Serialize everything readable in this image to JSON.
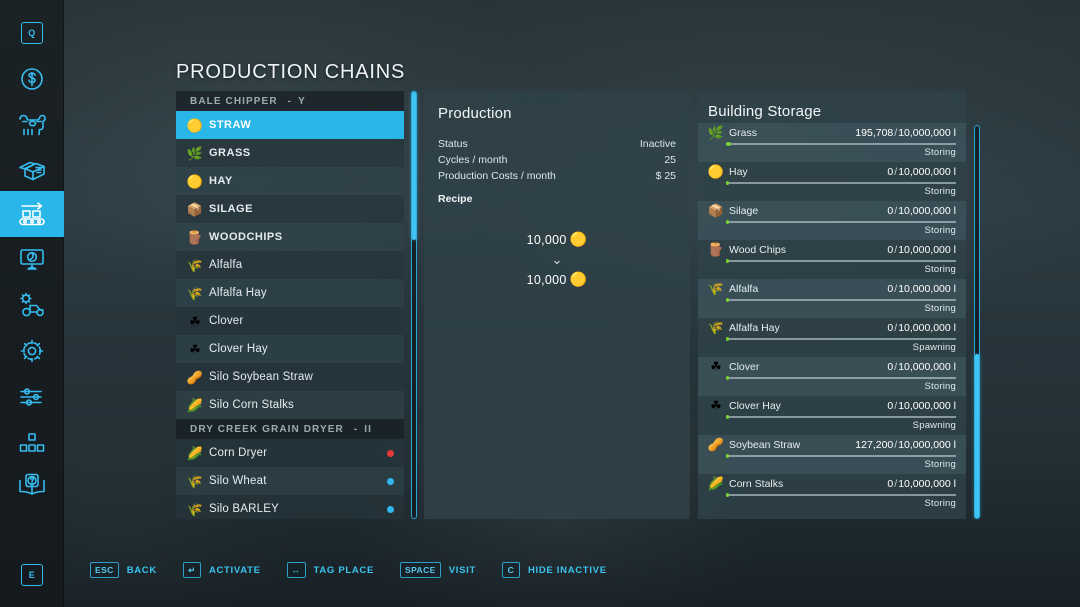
{
  "page_title": "PRODUCTION CHAINS",
  "sidebar": {
    "items": [
      {
        "name": "quests-icon",
        "label": "Q"
      },
      {
        "name": "finances-icon",
        "label": "$"
      },
      {
        "name": "animals-icon",
        "label": "Animals"
      },
      {
        "name": "contracts-icon",
        "label": "Contracts"
      },
      {
        "name": "production-icon",
        "label": "Production",
        "active": true
      },
      {
        "name": "map-overview-icon",
        "label": "Map Overview"
      },
      {
        "name": "vehicles-icon",
        "label": "Vehicles"
      },
      {
        "name": "settings-icon",
        "label": "Settings"
      },
      {
        "name": "game-settings-icon",
        "label": "Game Settings"
      },
      {
        "name": "statistics-icon",
        "label": "Statistics"
      },
      {
        "name": "help-icon",
        "label": "Help"
      },
      {
        "name": "exit-icon",
        "label": "E"
      }
    ]
  },
  "production_list": {
    "groups": [
      {
        "title": "BALE CHIPPER",
        "separator": "-",
        "suffix": "Y",
        "items": [
          {
            "label": "STRAW",
            "emoji": "🟡",
            "selected": true,
            "status": null
          },
          {
            "label": "GRASS",
            "emoji": "🌿",
            "selected": false,
            "status": null
          },
          {
            "label": "HAY",
            "emoji": "🟡",
            "selected": false,
            "status": null
          },
          {
            "label": "SILAGE",
            "emoji": "📦",
            "selected": false,
            "status": null
          },
          {
            "label": "WOODCHIPS",
            "emoji": "🪵",
            "selected": false,
            "status": null
          },
          {
            "label": "Alfalfa",
            "emoji": "🌾",
            "selected": false,
            "status": null
          },
          {
            "label": "Alfalfa Hay",
            "emoji": "🌾",
            "selected": false,
            "status": null
          },
          {
            "label": "Clover",
            "emoji": "☘",
            "selected": false,
            "status": null
          },
          {
            "label": "Clover Hay",
            "emoji": "☘",
            "selected": false,
            "status": null
          },
          {
            "label": "Silo Soybean Straw",
            "emoji": "🥜",
            "selected": false,
            "status": null
          },
          {
            "label": "Silo Corn Stalks",
            "emoji": "🌽",
            "selected": false,
            "status": null
          }
        ]
      },
      {
        "title": "DRY CREEK GRAIN DRYER",
        "separator": "-",
        "suffix": "II",
        "items": [
          {
            "label": "Corn Dryer",
            "emoji": "🌽",
            "selected": false,
            "status": "#e03a3a"
          },
          {
            "label": "Silo Wheat",
            "emoji": "🌾",
            "selected": false,
            "status": "#2fb8ef"
          },
          {
            "label": "Silo BARLEY",
            "emoji": "🌾",
            "selected": false,
            "status": "#2fb8ef"
          }
        ]
      }
    ]
  },
  "production": {
    "title": "Production",
    "stats": [
      {
        "label": "Status",
        "value": "Inactive"
      },
      {
        "label": "Cycles / month",
        "value": "25"
      },
      {
        "label": "Production Costs / month",
        "value": "$ 25"
      }
    ],
    "recipe_label": "Recipe",
    "recipe": {
      "input": {
        "amount": "10,000",
        "emoji": "🟡"
      },
      "arrow": "⌄",
      "output": {
        "amount": "10,000",
        "emoji": "🟡"
      }
    }
  },
  "building_storage": {
    "title": "Building Storage",
    "rows": [
      {
        "name": "Grass",
        "emoji": "🌿",
        "amount": "195,708",
        "capacity": "10,000,000 l",
        "state": "Storing",
        "fill_pct": 2.0
      },
      {
        "name": "Hay",
        "emoji": "🟡",
        "amount": "0",
        "capacity": "10,000,000 l",
        "state": "Storing",
        "fill_pct": 0
      },
      {
        "name": "Silage",
        "emoji": "📦",
        "amount": "0",
        "capacity": "10,000,000 l",
        "state": "Storing",
        "fill_pct": 0
      },
      {
        "name": "Wood Chips",
        "emoji": "🪵",
        "amount": "0",
        "capacity": "10,000,000 l",
        "state": "Storing",
        "fill_pct": 0
      },
      {
        "name": "Alfalfa",
        "emoji": "🌾",
        "amount": "0",
        "capacity": "10,000,000 l",
        "state": "Storing",
        "fill_pct": 0
      },
      {
        "name": "Alfalfa Hay",
        "emoji": "🌾",
        "amount": "0",
        "capacity": "10,000,000 l",
        "state": "Spawning",
        "fill_pct": 0
      },
      {
        "name": "Clover",
        "emoji": "☘",
        "amount": "0",
        "capacity": "10,000,000 l",
        "state": "Storing",
        "fill_pct": 0
      },
      {
        "name": "Clover Hay",
        "emoji": "☘",
        "amount": "0",
        "capacity": "10,000,000 l",
        "state": "Spawning",
        "fill_pct": 0
      },
      {
        "name": "Soybean Straw",
        "emoji": "🥜",
        "amount": "127,200",
        "capacity": "10,000,000 l",
        "state": "Storing",
        "fill_pct": 1.3
      },
      {
        "name": "Corn Stalks",
        "emoji": "🌽",
        "amount": "0",
        "capacity": "10,000,000 l",
        "state": "Storing",
        "fill_pct": 0
      }
    ],
    "separator": "/"
  },
  "footer": {
    "actions": [
      {
        "key": "ESC",
        "label": "BACK"
      },
      {
        "key": "↵",
        "label": "ACTIVATE"
      },
      {
        "key": "↔",
        "label": "TAG PLACE"
      },
      {
        "key": "SPACE",
        "label": "VISIT"
      },
      {
        "key": "C",
        "label": "HIDE INACTIVE"
      }
    ]
  },
  "colors": {
    "accent": "#29b6e8",
    "panel_bg": "#2f4248",
    "status_red": "#e03a3a",
    "status_blue": "#2fb8ef",
    "progress_green": "#76d130"
  }
}
